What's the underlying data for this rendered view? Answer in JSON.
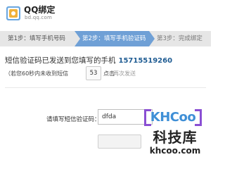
{
  "header": {
    "title": "QQ绑定",
    "subtitle": "bd.qq.com",
    "logo_icon": "qq-logo-icon"
  },
  "steps": [
    {
      "label": "第1步：填写手机号码",
      "state": "done"
    },
    {
      "label": "第2步：填写手机验证码",
      "state": "active"
    },
    {
      "label": "第3步：完成绑定",
      "state": "pending"
    }
  ],
  "sms": {
    "sent_text": "短信验证码已发送到您填写的手机",
    "phone": "15715519260",
    "retry_note": "（若您60秒内未收到短信",
    "countdown": "53",
    "click_text": "点击",
    "resend_text": "再次发送"
  },
  "form": {
    "code_label": "请填写短信验证码：",
    "code_value": "dfda",
    "submit_label": ""
  },
  "watermark": {
    "name": "KHCoo",
    "chinese": "科技库",
    "url": "khcoo.com"
  },
  "colors": {
    "active_step": "#6fa0d6",
    "inactive_step": "#e6e6e6",
    "phone": "#1f5c93",
    "watermark_accent": "#8a4fd3",
    "watermark_text": "#3f8fd6"
  }
}
